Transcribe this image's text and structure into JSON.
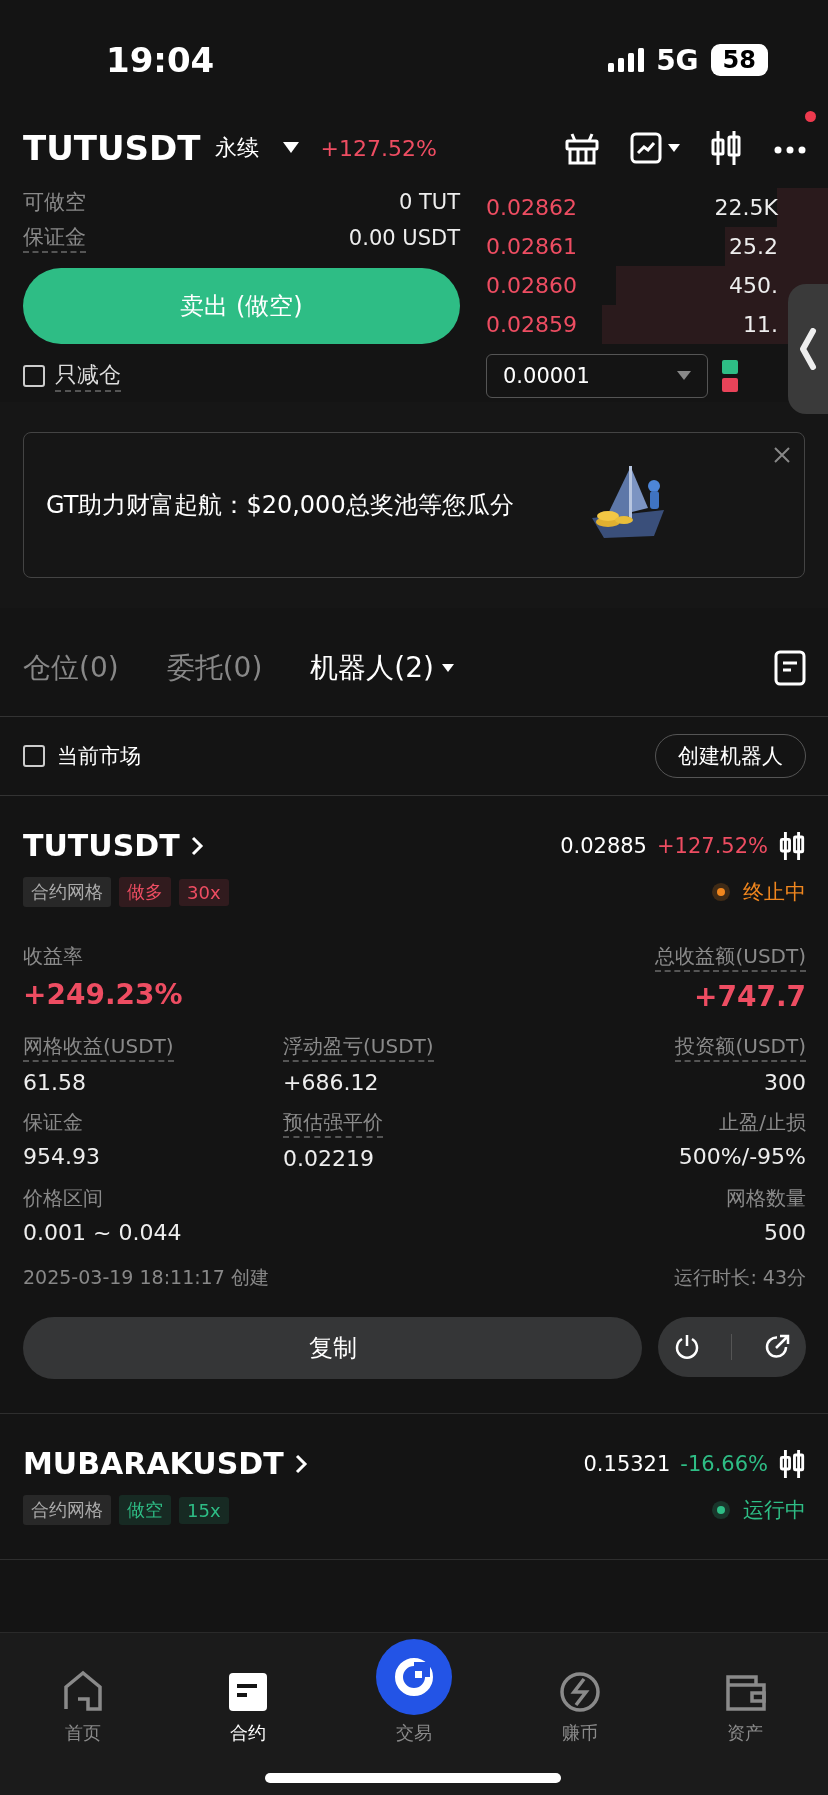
{
  "status_bar": {
    "time": "19:04",
    "network": "5G",
    "battery": "58"
  },
  "header": {
    "symbol": "TUTUSDT",
    "contract_type": "永续",
    "change": "+127.52%",
    "notification": true
  },
  "order_info": [
    {
      "label": "可做空",
      "value": "0 TUT",
      "dotted": false
    },
    {
      "label": "保证金",
      "value": "0.00 USDT",
      "dotted": true
    }
  ],
  "sell_button": "卖出 (做空)",
  "reduce_only": {
    "label": "只减仓",
    "checked": false
  },
  "order_book": [
    {
      "price": "0.02862",
      "amount": "22.5K"
    },
    {
      "price": "0.02861",
      "amount": "25.2"
    },
    {
      "price": "0.02860",
      "amount": "450."
    },
    {
      "price": "0.02859",
      "amount": "11."
    }
  ],
  "precision": "0.00001",
  "banner": {
    "text": "GT助力财富起航：$20,000总奖池等您瓜分"
  },
  "tabs": [
    {
      "label": "仓位(0)",
      "selected": false,
      "dropdown": false
    },
    {
      "label": "委托(0)",
      "selected": false,
      "dropdown": false
    },
    {
      "label": "机器人(2)",
      "selected": true,
      "dropdown": true
    }
  ],
  "filter": {
    "label": "当前市场",
    "checked": false
  },
  "create_button": "创建机器人",
  "bots": [
    {
      "symbol": "TUTUSDT",
      "price": "0.02885",
      "change": "+127.52%",
      "color": "#ee4d62",
      "tags": [
        {
          "label": "合约网格",
          "color": "#aaaaaa"
        },
        {
          "label": "做多",
          "color": "#ee4d62"
        },
        {
          "label": "30x",
          "color": "#ee4d62"
        }
      ],
      "status": {
        "label": "终止中",
        "color": "#f0861e"
      },
      "return_label": "收益率",
      "return_value": "+249.23%",
      "total_label": "总收益额(USDT)",
      "total_value": "+747.7",
      "stats": [
        {
          "left": {
            "label": "网格收益(USDT)",
            "value": "61.58",
            "dotted": true
          },
          "middle": {
            "label": "浮动盈亏(USDT)",
            "value": "+686.12",
            "dotted": true
          },
          "right": {
            "label": "投资额(USDT)",
            "value": "300",
            "dotted": true
          }
        },
        {
          "left": {
            "label": "保证金",
            "value": "954.93",
            "dotted": false
          },
          "middle": {
            "label": "预估强平价",
            "value": "0.02219",
            "dotted": true
          },
          "right": {
            "label": "止盈/止损",
            "value": "500%/-95%",
            "dotted": false
          }
        },
        {
          "left": {
            "label": "价格区间",
            "value": "0.001 ~ 0.044",
            "dotted": false
          },
          "right": {
            "label": "网格数量",
            "value": "500",
            "dotted": false
          }
        }
      ],
      "created": "2025-03-19 18:11:17 创建",
      "runtime": "运行时长: 43分",
      "copy_button": "复制"
    },
    {
      "symbol": "MUBARAKUSDT",
      "price": "0.15321",
      "change": "-16.66%",
      "color": "#2ebd85",
      "tags": [
        {
          "label": "合约网格",
          "color": "#aaaaaa"
        },
        {
          "label": "做空",
          "color": "#2ebd85"
        },
        {
          "label": "15x",
          "color": "#2ebd85"
        }
      ],
      "status": {
        "label": "运行中",
        "color": "#2ebd85"
      }
    }
  ],
  "nav": [
    {
      "label": "首页",
      "kind": "home",
      "selected": false
    },
    {
      "label": "合约",
      "kind": "futures",
      "selected": true
    },
    {
      "label": "交易",
      "kind": "trade",
      "selected": false
    },
    {
      "label": "赚币",
      "kind": "earn",
      "selected": false
    },
    {
      "label": "资产",
      "kind": "assets",
      "selected": false
    }
  ]
}
